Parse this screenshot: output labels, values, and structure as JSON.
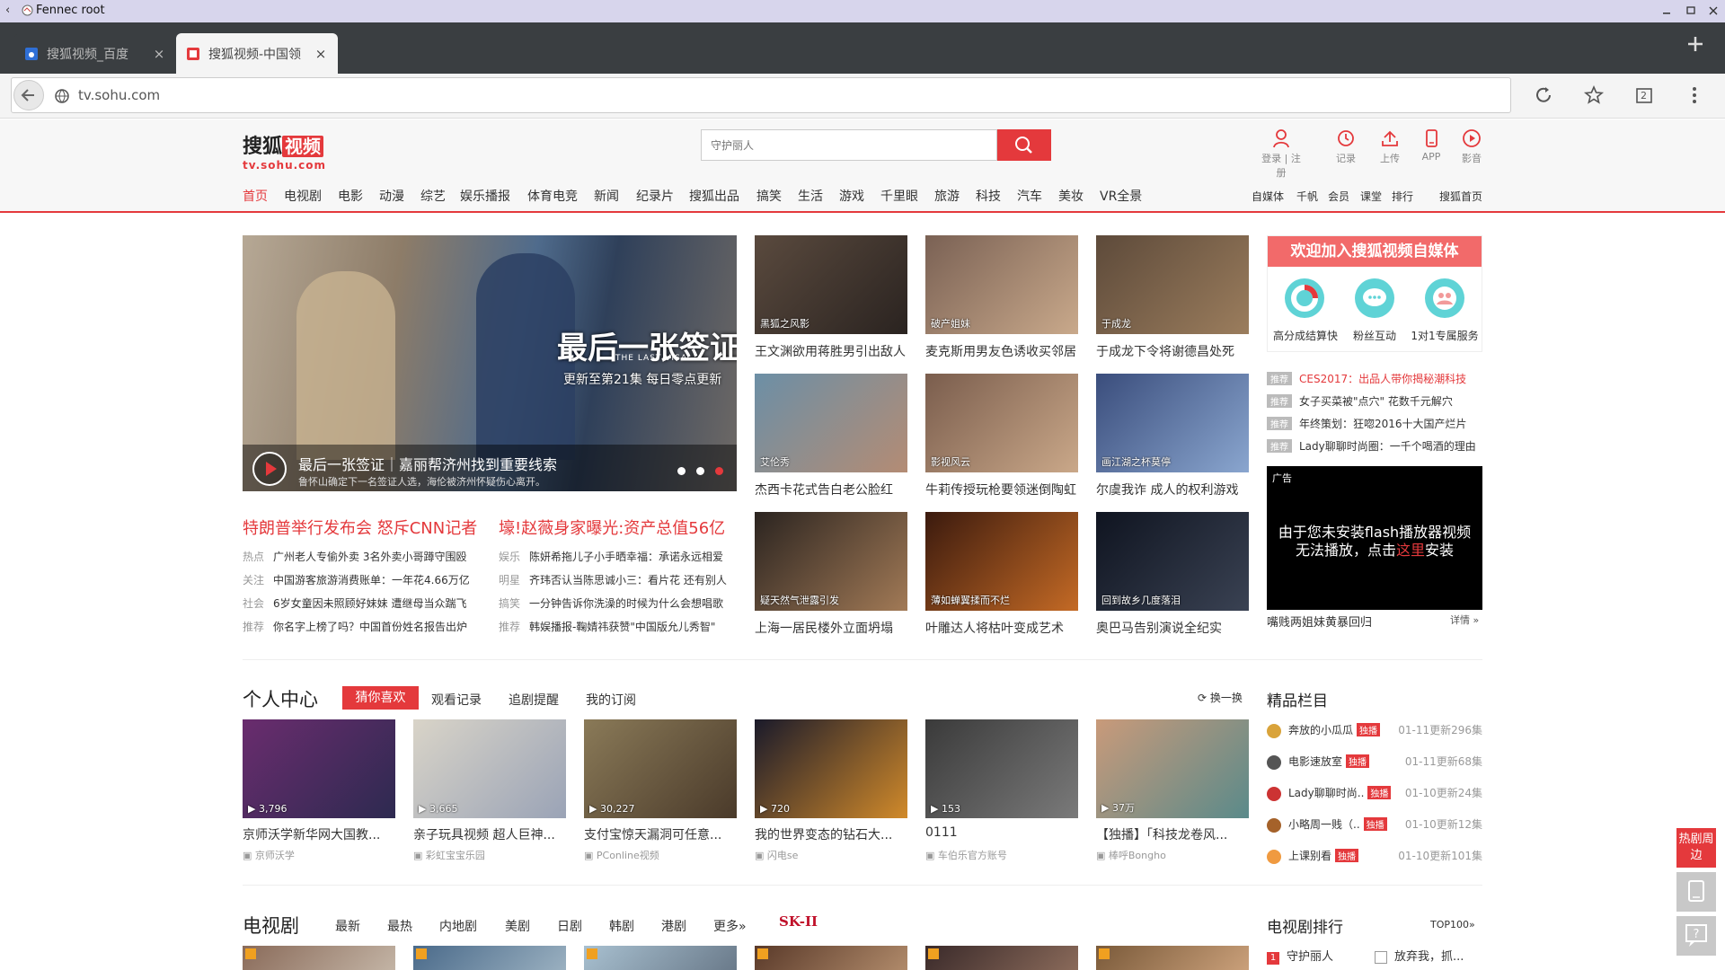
{
  "window": {
    "title": "Fennec root",
    "back_glyph": "‹"
  },
  "tabs": [
    {
      "label": "搜狐视频_百度",
      "close": "×",
      "active": false
    },
    {
      "label": "搜狐视频-中国领",
      "close": "×",
      "active": true
    }
  ],
  "address": {
    "url": "tv.sohu.com"
  },
  "browser": {
    "tab_count": "2"
  },
  "site": {
    "logo_text_left": "搜狐",
    "logo_text_box": "视频",
    "logo_domain": "tv.sohu.com",
    "search_placeholder": "守护丽人",
    "header_icons": [
      {
        "icon": "user-icon",
        "label": "登录",
        "label2": "注册"
      },
      {
        "icon": "history-icon",
        "label": "记录"
      },
      {
        "icon": "upload-icon",
        "label": "上传"
      },
      {
        "icon": "phone-icon",
        "label": "APP"
      },
      {
        "icon": "play-circle-icon",
        "label": "影音"
      }
    ],
    "nav": [
      "首页",
      "电视剧",
      "电影",
      "动漫",
      "综艺",
      "娱乐播报",
      "体育电竞",
      "新闻",
      "纪录片",
      "搜狐出品",
      "搞笑",
      "生活",
      "游戏",
      "千里眼",
      "旅游",
      "科技",
      "汽车",
      "美妆",
      "VR全景"
    ],
    "nav_right": [
      "自媒体",
      "千帆",
      "会员",
      "课堂",
      "排行",
      "搜狐首页"
    ],
    "colors": {
      "accent": "#e4393c"
    }
  },
  "hero": {
    "title_art": "最后一张签证",
    "subtitle_en": "THE LAST VISA",
    "update": "更新至第21集 每日零点更新",
    "caption": "最后一张签证｜嘉丽帮济州找到重要线索",
    "desc": "鲁怀山确定下一名签证人选，海伦被济州怀疑伤心离开。"
  },
  "headlines": [
    "特朗普举行发布会 怒斥CNN记者",
    "壕!赵薇身家曝光:资产总值56亿"
  ],
  "news_left": [
    {
      "tag": "热点",
      "text": "广州老人专偷外卖 3名外卖小哥蹲守围殴"
    },
    {
      "tag": "关注",
      "text": "中国游客旅游消费账单：一年花4.66万亿"
    },
    {
      "tag": "社会",
      "text": "6岁女童因未照顾好妹妹 遭继母当众踹飞"
    },
    {
      "tag": "推荐",
      "text": "你名字上榜了吗？中国首份姓名报告出炉"
    }
  ],
  "news_right": [
    {
      "tag": "娱乐",
      "text": "陈妍希拖儿子小手晒幸福：承诺永远相爱"
    },
    {
      "tag": "明星",
      "text": "齐玮否认当陈思诚小三：看片花 还有别人"
    },
    {
      "tag": "搞笑",
      "text": "一分钟告诉你洗澡的时候为什么会想唱歌"
    },
    {
      "tag": "推荐",
      "text": "韩娱播报-鞠婧祎获赞\"中国版允儿秀智\""
    }
  ],
  "grid": [
    {
      "overlay": "黑狐之风影",
      "caption": "王文渊欲用蒋胜男引出敌人"
    },
    {
      "overlay": "破产姐妹",
      "caption": "麦克斯用男友色诱收买邻居"
    },
    {
      "overlay": "于成龙",
      "caption": "于成龙下令将谢德昌处死"
    },
    {
      "overlay": "艾伦秀",
      "caption": "杰西卡花式告白老公脸红"
    },
    {
      "overlay": "影视风云",
      "caption": "牛莉传授玩枪要领迷倒陶虹"
    },
    {
      "overlay": "画江湖之杯莫停",
      "caption": "尔虞我诈 成人的权利游戏"
    },
    {
      "overlay": "疑天然气泄露引发",
      "caption": "上海一居民楼外立面坍塌"
    },
    {
      "overlay": "薄如蝉翼揉而不烂",
      "caption": "叶雕达人将枯叶变成艺术"
    },
    {
      "overlay": "回到故乡几度落泪",
      "caption": "奥巴马告别演说全纪实"
    }
  ],
  "we_media": {
    "banner": "欢迎加入搜狐视频自媒体",
    "items": [
      "高分成结算快",
      "粉丝互动",
      "1对1专属服务"
    ]
  },
  "recommend": [
    {
      "tag": "推荐",
      "text": "CES2017：出品人带你揭秘潮科技",
      "red": true
    },
    {
      "tag": "推荐",
      "text": "女子买菜被\"点穴\" 花数千元解穴"
    },
    {
      "tag": "推荐",
      "text": "年终策划：狂唿2016十大国产烂片"
    },
    {
      "tag": "推荐",
      "text": "Lady聊聊时尚圈：一千个喝酒的理由"
    }
  ],
  "ad": {
    "label": "广告",
    "line1": "由于您未安装flash播放器视频",
    "line2a": "无法播放，点击",
    "line2b": "这里",
    "line2c": "安装",
    "footer": "嘴贱两姐妹黄暴回归",
    "more": "详情"
  },
  "personal": {
    "title": "个人中心",
    "tabs": [
      "猜你喜欢",
      "观看记录",
      "追剧提醒",
      "我的订阅"
    ],
    "refresh": "换一换",
    "videos": [
      {
        "plays": "3,796",
        "title": "京师沃学新华网大国教...",
        "channel": "京师沃学"
      },
      {
        "plays": "3,665",
        "title": "亲子玩具视频 超人巨神...",
        "channel": "彩虹宝宝乐园"
      },
      {
        "plays": "30,227",
        "title": "支付宝惊天漏洞可任意...",
        "channel": "PConline视频"
      },
      {
        "plays": "720",
        "title": "我的世界变态的钻石大...",
        "channel": "闪电se"
      },
      {
        "plays": "153",
        "title": "0111",
        "channel": "车伯乐官方账号"
      },
      {
        "plays": "37万",
        "title": "【独播】「科技龙卷风...",
        "channel": "棒呼Bongho"
      }
    ]
  },
  "featured": {
    "title": "精品栏目",
    "hot_label": "独播",
    "items": [
      {
        "name": "奔放的小瓜瓜",
        "update": "01-11更新296集"
      },
      {
        "name": "电影速放室",
        "update": "01-11更新68集"
      },
      {
        "name": "Lady聊聊时尚..",
        "update": "01-10更新24集"
      },
      {
        "name": "小略周一贱（..",
        "update": "01-10更新12集"
      },
      {
        "name": "上课别看",
        "update": "01-10更新101集"
      }
    ]
  },
  "tv": {
    "title": "电视剧",
    "tabs": [
      "最新",
      "最热",
      "内地剧",
      "美剧",
      "日剧",
      "韩剧",
      "港剧",
      "更多"
    ],
    "sponsor": "SK-II",
    "rank_title": "电视剧排行",
    "rank_more": "TOP100",
    "rank": [
      {
        "num": "1",
        "name": "守护丽人"
      },
      {
        "num": "",
        "name": "放弃我，抓..."
      }
    ]
  },
  "side": {
    "hot_nearby": "热剧周边"
  }
}
